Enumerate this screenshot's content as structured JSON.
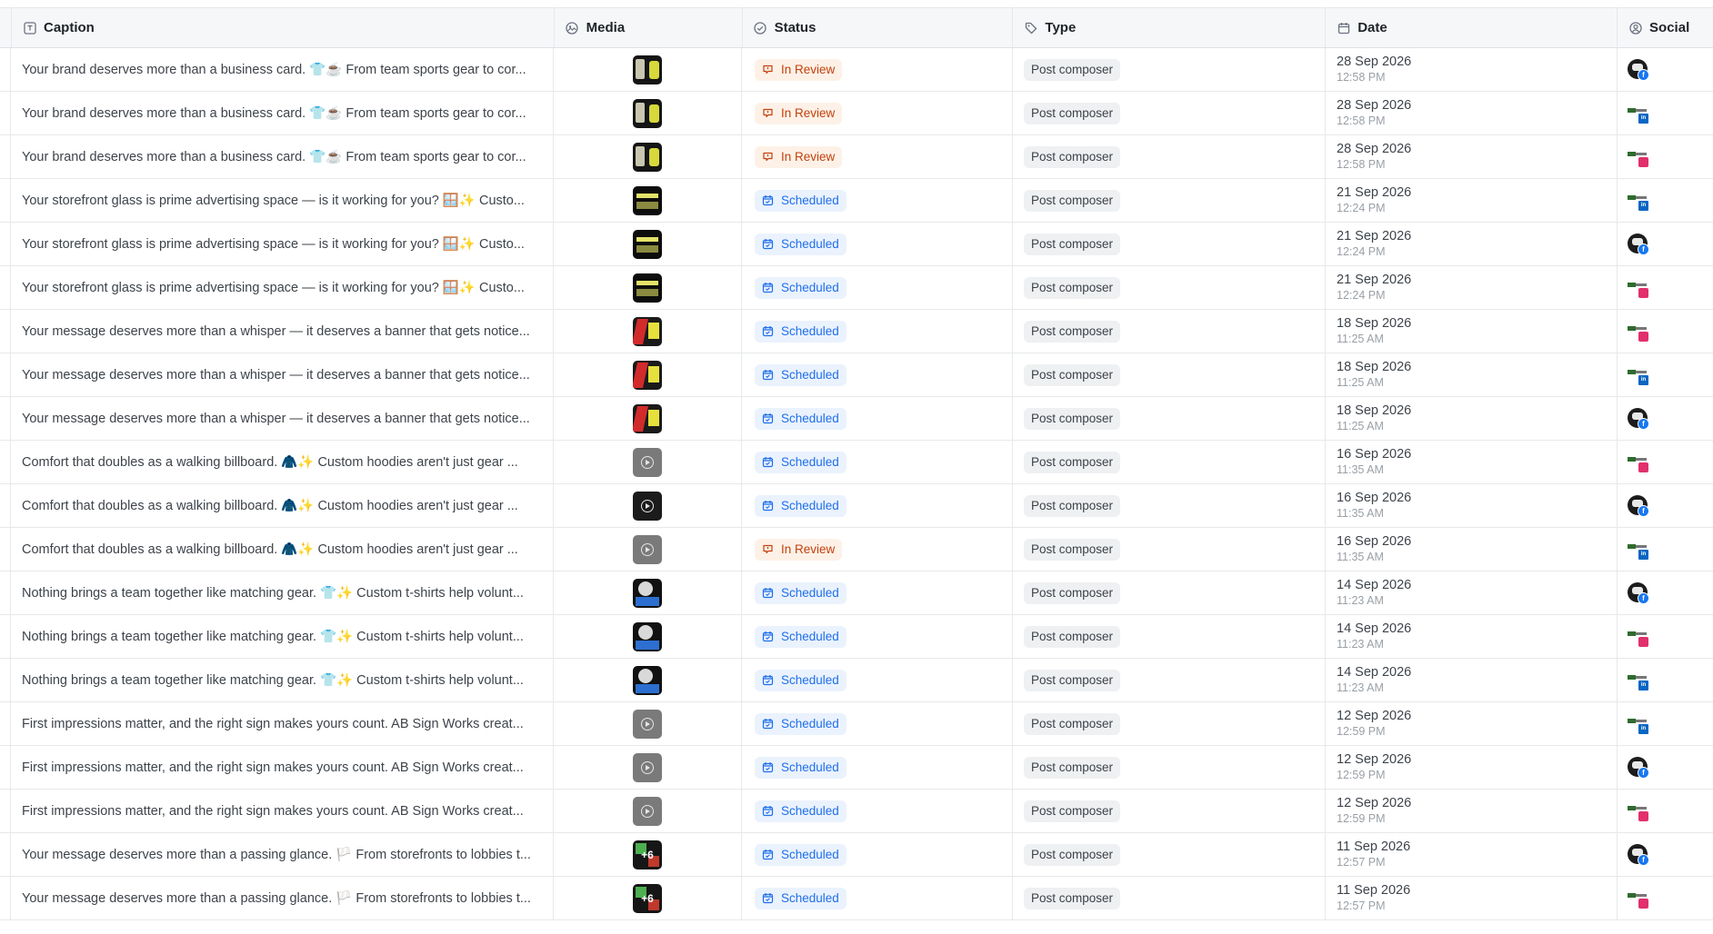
{
  "columns": {
    "caption": "Caption",
    "media": "Media",
    "status": "Status",
    "type": "Type",
    "date": "Date",
    "social": "Social"
  },
  "rows": [
    {
      "caption": "Your brand deserves more than a business card. 👕☕ From team sports gear to cor...",
      "thumb": "t-dark",
      "status": "In Review",
      "type": "Post composer",
      "date": "28 Sep 2026",
      "time": "12:58 PM",
      "avatar": "facebook"
    },
    {
      "caption": "Your brand deserves more than a business card. 👕☕ From team sports gear to cor...",
      "thumb": "t-dark",
      "status": "In Review",
      "type": "Post composer",
      "date": "28 Sep 2026",
      "time": "12:58 PM",
      "avatar": "linkedin"
    },
    {
      "caption": "Your brand deserves more than a business card. 👕☕ From team sports gear to cor...",
      "thumb": "t-dark",
      "status": "In Review",
      "type": "Post composer",
      "date": "28 Sep 2026",
      "time": "12:58 PM",
      "avatar": "instagram"
    },
    {
      "caption": "Your storefront glass is prime advertising space — is it working for you? 🪟✨ Custo...",
      "thumb": "t-store",
      "status": "Scheduled",
      "type": "Post composer",
      "date": "21 Sep 2026",
      "time": "12:24 PM",
      "avatar": "linkedin"
    },
    {
      "caption": "Your storefront glass is prime advertising space — is it working for you? 🪟✨ Custo...",
      "thumb": "t-store",
      "status": "Scheduled",
      "type": "Post composer",
      "date": "21 Sep 2026",
      "time": "12:24 PM",
      "avatar": "facebook"
    },
    {
      "caption": "Your storefront glass is prime advertising space — is it working for you? 🪟✨ Custo...",
      "thumb": "t-store",
      "status": "Scheduled",
      "type": "Post composer",
      "date": "21 Sep 2026",
      "time": "12:24 PM",
      "avatar": "instagram"
    },
    {
      "caption": "Your message deserves more than a whisper — it deserves a banner that gets notice...",
      "thumb": "t-red",
      "status": "Scheduled",
      "type": "Post composer",
      "date": "18 Sep 2026",
      "time": "11:25 AM",
      "avatar": "instagram"
    },
    {
      "caption": "Your message deserves more than a whisper — it deserves a banner that gets notice...",
      "thumb": "t-red",
      "status": "Scheduled",
      "type": "Post composer",
      "date": "18 Sep 2026",
      "time": "11:25 AM",
      "avatar": "linkedin"
    },
    {
      "caption": "Your message deserves more than a whisper — it deserves a banner that gets notice...",
      "thumb": "t-red",
      "status": "Scheduled",
      "type": "Post composer",
      "date": "18 Sep 2026",
      "time": "11:25 AM",
      "avatar": "facebook"
    },
    {
      "caption": "Comfort that doubles as a walking billboard. 🧥✨ Custom hoodies aren't just gear ...",
      "thumb": "t-video",
      "status": "Scheduled",
      "type": "Post composer",
      "date": "16 Sep 2026",
      "time": "11:35 AM",
      "avatar": "instagram"
    },
    {
      "caption": "Comfort that doubles as a walking billboard. 🧥✨ Custom hoodies aren't just gear ...",
      "thumb": "t-video2",
      "status": "Scheduled",
      "type": "Post composer",
      "date": "16 Sep 2026",
      "time": "11:35 AM",
      "avatar": "facebook"
    },
    {
      "caption": "Comfort that doubles as a walking billboard. 🧥✨ Custom hoodies aren't just gear ...",
      "thumb": "t-video",
      "status": "In Review",
      "type": "Post composer",
      "date": "16 Sep 2026",
      "time": "11:35 AM",
      "avatar": "linkedin"
    },
    {
      "caption": "Nothing brings a team together like matching gear. 👕✨ Custom t-shirts help volunt...",
      "thumb": "t-team",
      "status": "Scheduled",
      "type": "Post composer",
      "date": "14 Sep 2026",
      "time": "11:23 AM",
      "avatar": "facebook"
    },
    {
      "caption": "Nothing brings a team together like matching gear. 👕✨ Custom t-shirts help volunt...",
      "thumb": "t-team",
      "status": "Scheduled",
      "type": "Post composer",
      "date": "14 Sep 2026",
      "time": "11:23 AM",
      "avatar": "instagram"
    },
    {
      "caption": "Nothing brings a team together like matching gear. 👕✨ Custom t-shirts help volunt...",
      "thumb": "t-team",
      "status": "Scheduled",
      "type": "Post composer",
      "date": "14 Sep 2026",
      "time": "11:23 AM",
      "avatar": "linkedin"
    },
    {
      "caption": "First impressions matter, and the right sign makes yours count. AB Sign Works creat...",
      "thumb": "t-video",
      "status": "Scheduled",
      "type": "Post composer",
      "date": "12 Sep 2026",
      "time": "12:59 PM",
      "avatar": "linkedin"
    },
    {
      "caption": "First impressions matter, and the right sign makes yours count. AB Sign Works creat...",
      "thumb": "t-video",
      "status": "Scheduled",
      "type": "Post composer",
      "date": "12 Sep 2026",
      "time": "12:59 PM",
      "avatar": "facebook"
    },
    {
      "caption": "First impressions matter, and the right sign makes yours count. AB Sign Works creat...",
      "thumb": "t-video",
      "status": "Scheduled",
      "type": "Post composer",
      "date": "12 Sep 2026",
      "time": "12:59 PM",
      "avatar": "instagram"
    },
    {
      "caption": "Your message deserves more than a passing glance. 🏳️ From storefronts to lobbies t...",
      "thumb": "t-multi",
      "overlay": "+6",
      "status": "Scheduled",
      "type": "Post composer",
      "date": "11 Sep 2026",
      "time": "12:57 PM",
      "avatar": "facebook"
    },
    {
      "caption": "Your message deserves more than a passing glance. 🏳️ From storefronts to lobbies t...",
      "thumb": "t-multi",
      "overlay": "+6",
      "status": "Scheduled",
      "type": "Post composer",
      "date": "11 Sep 2026",
      "time": "12:57 PM",
      "avatar": "instagram"
    }
  ],
  "colors": {
    "in_review": "#c2410c",
    "scheduled": "#1f6feb",
    "facebook": "#1877f2",
    "linkedin": "#0a66c2",
    "instagram": "#e1306c"
  }
}
